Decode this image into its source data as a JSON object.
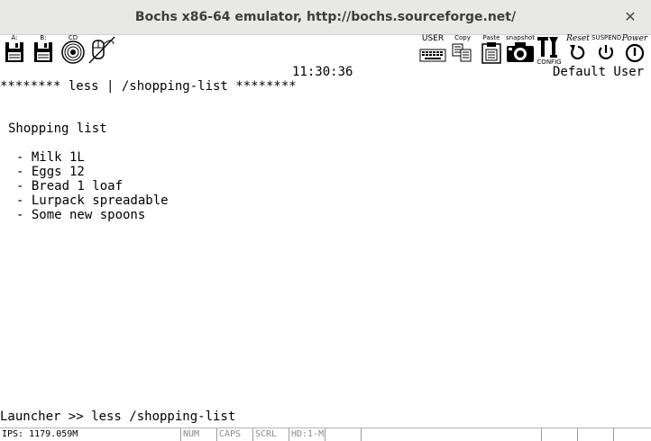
{
  "window": {
    "title": "Bochs x86-64 emulator, http://bochs.sourceforge.net/",
    "close_symbol": "✕"
  },
  "toolbar": {
    "floppy_a_label": "A:",
    "floppy_b_label": "B:",
    "cdrom_label": "CD",
    "user_label": "USER",
    "copy_label": "Copy",
    "paste_label": "Paste",
    "snapshot_label": "snapshot",
    "config_label": "CONFIG",
    "reset_label": "Reset",
    "suspend_label": "SUSPEND",
    "power_label": "Power"
  },
  "screen": {
    "clock": "11:30:36",
    "user": "Default User",
    "header_line": "******** less | /shopping-list ********",
    "content_title": "Shopping list",
    "items": [
      "- Milk 1L",
      "- Eggs 12",
      "- Bread 1 loaf",
      "- Lurpack spreadable",
      "- Some new spoons"
    ],
    "prompt": "Launcher >> less /shopping-list"
  },
  "statusbar": {
    "ips": "IPS: 1179.059M",
    "num": "NUM",
    "caps": "CAPS",
    "scrl": "SCRL",
    "hd": "HD:1-M"
  }
}
